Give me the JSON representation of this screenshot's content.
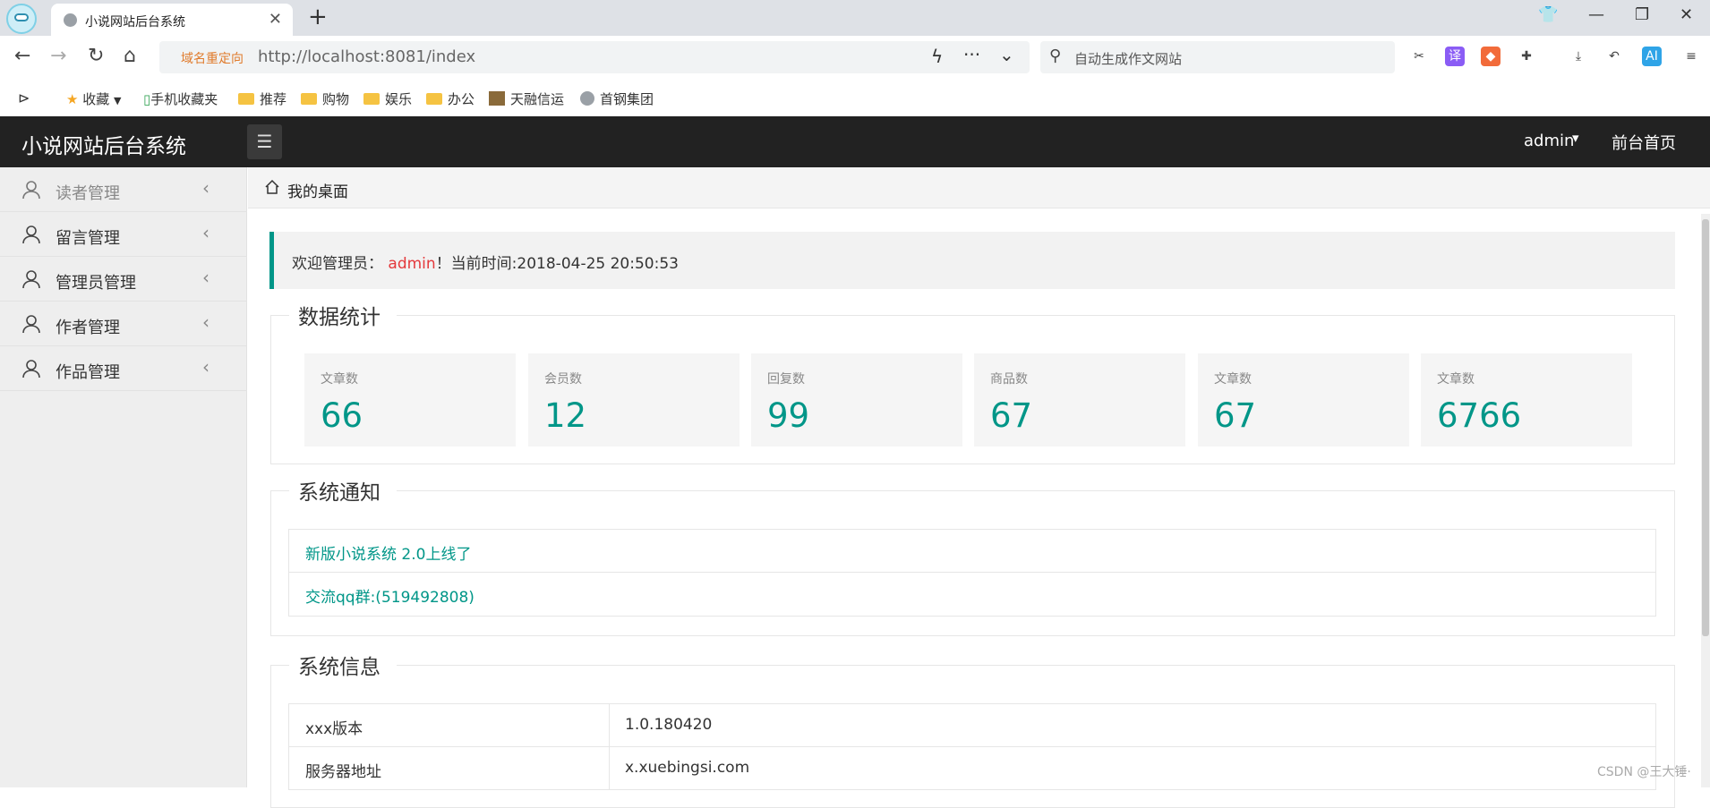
{
  "browser": {
    "tab_title": "小说网站后台系统",
    "address": {
      "redirect_tag": "域名重定向",
      "url": "http://localhost:8081/index"
    },
    "search": {
      "placeholder": "自动生成作文网站"
    },
    "bookmarks": [
      "收藏",
      "手机收藏夹",
      "推荐",
      "购物",
      "娱乐",
      "办公",
      "天融信运",
      "首钢集团"
    ]
  },
  "header": {
    "title": "小说网站后台系统",
    "user": "admin",
    "front_link": "前台首页"
  },
  "sidebar": {
    "items": [
      {
        "label": "读者管理"
      },
      {
        "label": "留言管理"
      },
      {
        "label": "管理员管理"
      },
      {
        "label": "作者管理"
      },
      {
        "label": "作品管理"
      }
    ]
  },
  "breadcrumb": "我的桌面",
  "welcome": {
    "prefix": "欢迎管理员：",
    "user": "admin",
    "suffix": "！当前时间:2018-04-25 20:50:53"
  },
  "stats": {
    "legend": "数据统计",
    "cards": [
      {
        "label": "文章数",
        "value": "66"
      },
      {
        "label": "会员数",
        "value": "12"
      },
      {
        "label": "回复数",
        "value": "99"
      },
      {
        "label": "商品数",
        "value": "67"
      },
      {
        "label": "文章数",
        "value": "67"
      },
      {
        "label": "文章数",
        "value": "6766"
      }
    ]
  },
  "notices": {
    "legend": "系统通知",
    "items": [
      "新版小说系统 2.0上线了",
      "交流qq群:(519492808)"
    ]
  },
  "system_info": {
    "legend": "系统信息",
    "rows": [
      {
        "key": "xxx版本",
        "value": "1.0.180420"
      },
      {
        "key": "服务器地址",
        "value": "x.xuebingsi.com"
      }
    ]
  },
  "watermark": "CSDN @王大锤·",
  "colors": {
    "accent": "#009688",
    "header_bg": "#222222",
    "highlight": "#e4393c"
  }
}
